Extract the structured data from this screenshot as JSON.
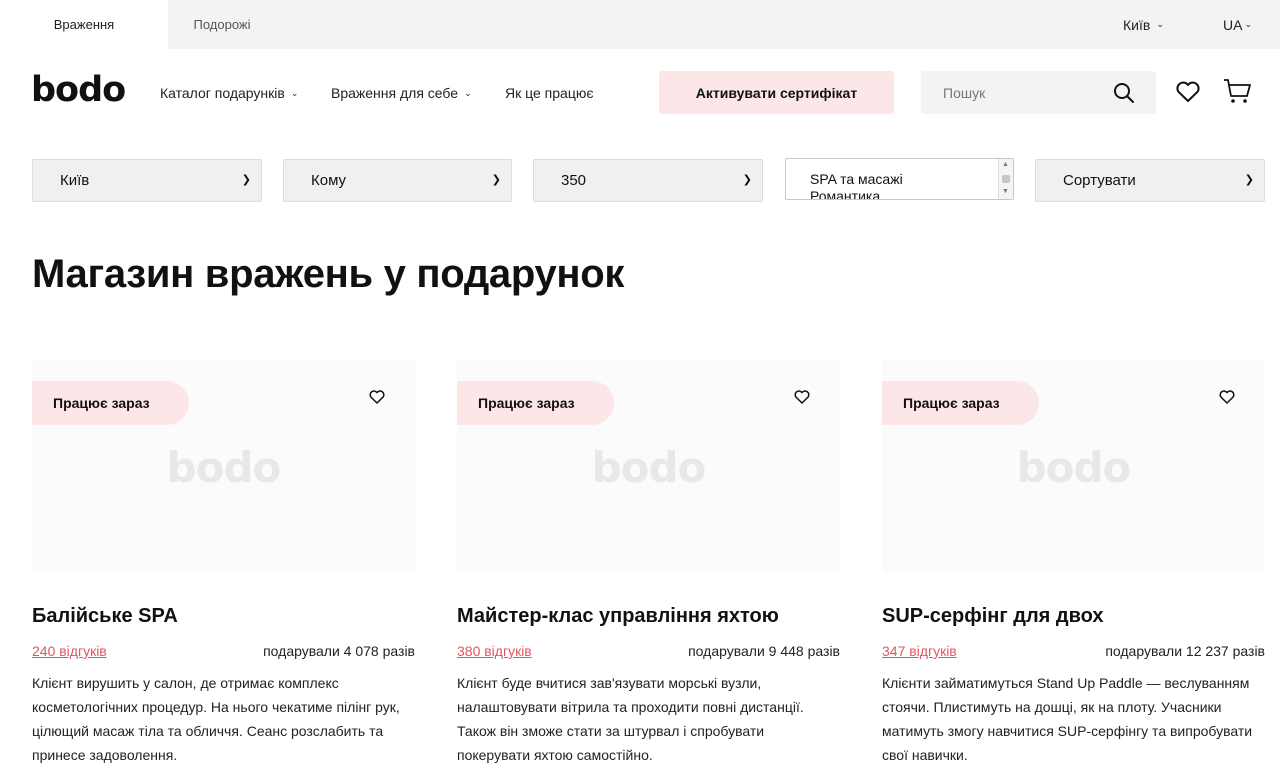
{
  "topbar": {
    "tabs": [
      {
        "label": "Враження"
      },
      {
        "label": "Подорожі"
      }
    ],
    "city": "Київ",
    "language": "UA"
  },
  "header": {
    "logo": "bodo",
    "nav": [
      {
        "label": "Каталог подарунків",
        "has_dropdown": true
      },
      {
        "label": "Враження для себе",
        "has_dropdown": true
      },
      {
        "label": "Як це працює",
        "has_dropdown": false
      }
    ],
    "activate_label": "Активувати сертифікат",
    "search_placeholder": "Пошук",
    "icons": [
      "search-icon",
      "heart-icon",
      "cart-icon"
    ],
    "accent_color": "#fde6e8"
  },
  "filters": {
    "city": "Київ",
    "recipient": "Кому",
    "price": "350",
    "categories": [
      "SPA та масажі",
      "Романтика"
    ],
    "sort": "Сортувати"
  },
  "page_title": "Магазин вражень у подарунок",
  "cards": [
    {
      "badge": "Працює зараз",
      "watermark": "bodo",
      "title": "Балійське SPA",
      "reviews": "240 відгуків",
      "gifted": "подарували 4 078 разів",
      "description": "Клієнт вирушить у салон, де отримає комплекс косметологічних процедур. На нього чекатиме пілінг рук, цілющий масаж тіла та обличчя. Сеанс розслабить та принесе задоволення."
    },
    {
      "badge": "Працює зараз",
      "watermark": "bodo",
      "title": "Майстер-клас управління яхтою",
      "reviews": "380 відгуків",
      "gifted": "подарували 9 448 разів",
      "description": "Клієнт буде вчитися зав'язувати морські вузли, налаштовувати вітрила та проходити повні дистанції. Також він зможе стати за штурвал і спробувати покерувати яхтою самостійно."
    },
    {
      "badge": "Працює зараз",
      "watermark": "bodo",
      "title": "SUP-серфінг для двох",
      "reviews": "347 відгуків",
      "gifted": "подарували 12 237 разів",
      "description": "Клієнти займатимуться Stand Up Paddle — веслуванням стоячи. Плистимуть на дошці, як на плоту. Учасники матимуть змогу навчитися SUP-серфінгу та випробувати свої навички."
    }
  ]
}
